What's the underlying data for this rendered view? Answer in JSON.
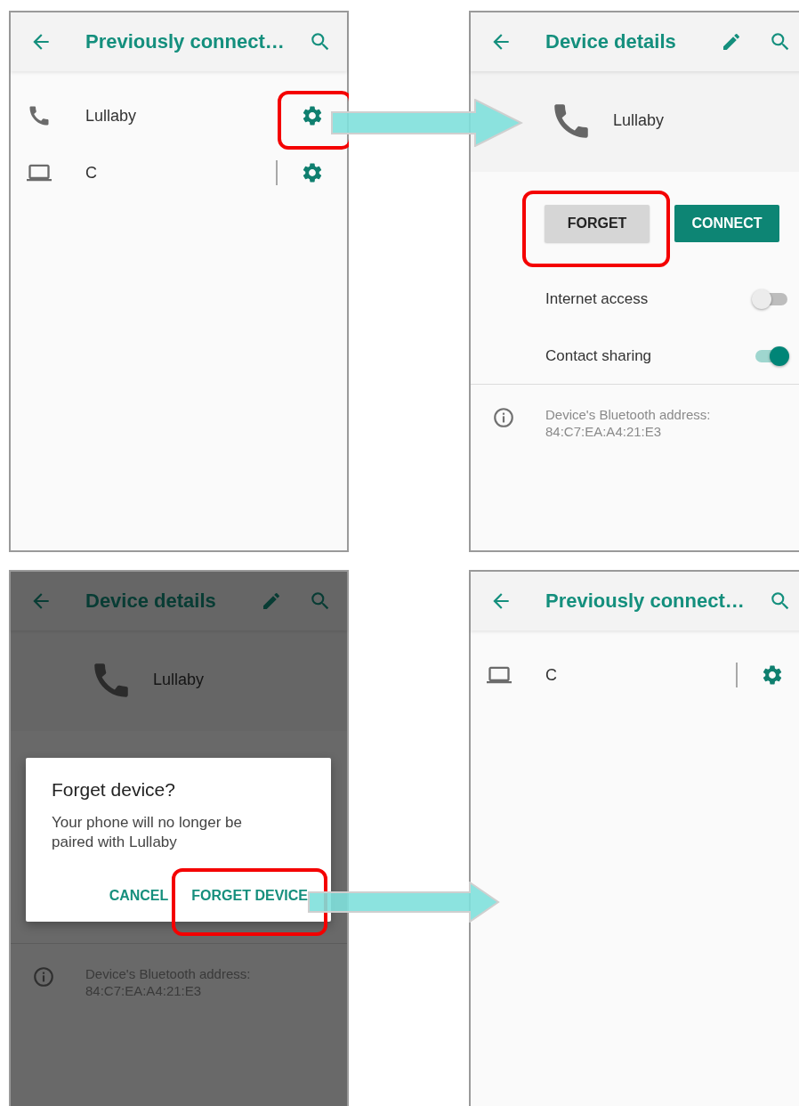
{
  "panels": [
    {
      "kind": "device_list",
      "title": "Previously connect…",
      "devices": [
        {
          "kind": "phone",
          "name": "Lullaby",
          "separator": false,
          "highlighted": true
        },
        {
          "kind": "laptop",
          "name": "C",
          "separator": true,
          "highlighted": false
        }
      ]
    },
    {
      "kind": "device_details",
      "title": "Device details",
      "device": {
        "kind": "phone",
        "name": "Lullaby"
      },
      "buttons": [
        {
          "kind": "secondary",
          "label": "FORGET",
          "highlighted": true
        },
        {
          "kind": "primary",
          "label": "CONNECT",
          "highlighted": false
        }
      ],
      "toggles": [
        {
          "label": "Internet access",
          "on": false
        },
        {
          "label": "Contact sharing",
          "on": true
        }
      ],
      "info": "Device's Bluetooth address:\n84:C7:EA:A4:21:E3"
    },
    {
      "kind": "device_details",
      "title": "Device details",
      "device": {
        "kind": "phone",
        "name": "Lullaby"
      },
      "info": "Device's Bluetooth address:\n84:C7:EA:A4:21:E3",
      "dialog": {
        "title": "Forget device?",
        "message": "Your phone will no longer be paired with Lullaby",
        "actions": [
          {
            "label": "CANCEL",
            "highlighted": false
          },
          {
            "label": "FORGET DEVICE",
            "highlighted": true
          }
        ]
      }
    },
    {
      "kind": "device_list",
      "title": "Previously connect…",
      "devices": [
        {
          "kind": "laptop",
          "name": "C",
          "separator": true,
          "highlighted": false
        }
      ]
    }
  ]
}
